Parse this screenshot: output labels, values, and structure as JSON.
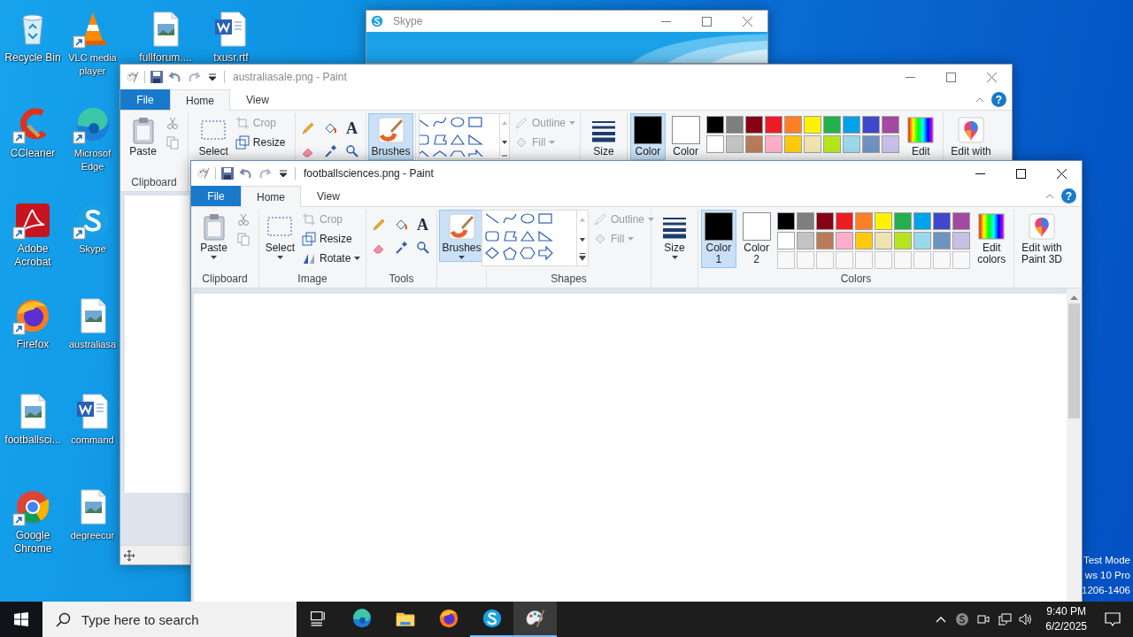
{
  "desktop": {
    "icon_columns": [
      [
        {
          "label": "Recycle Bin",
          "kind": "recycle-bin",
          "shortcut": false
        },
        {
          "label": "CCleaner",
          "kind": "ccleaner",
          "shortcut": true
        },
        {
          "label": "Adobe Acrobat",
          "kind": "acrobat",
          "shortcut": true
        },
        {
          "label": "Firefox",
          "kind": "firefox",
          "shortcut": true
        },
        {
          "label": "footballsci...",
          "kind": "image",
          "shortcut": false
        },
        {
          "label": "Google Chrome",
          "kind": "chrome",
          "shortcut": true
        }
      ],
      [
        {
          "label": "VLC media player",
          "kind": "vlc",
          "shortcut": true
        },
        {
          "label": "Microsof Edge",
          "kind": "edge",
          "shortcut": true
        },
        {
          "label": "Skype",
          "kind": "skype",
          "shortcut": true
        },
        {
          "label": "australiasa",
          "kind": "image",
          "shortcut": false
        },
        {
          "label": "command",
          "kind": "word",
          "shortcut": false
        },
        {
          "label": "degreecur",
          "kind": "image",
          "shortcut": false
        }
      ],
      [
        {
          "label": "fullforum....",
          "kind": "image",
          "shortcut": false
        }
      ],
      [
        {
          "label": "txusr.rtf",
          "kind": "word",
          "shortcut": false
        }
      ]
    ],
    "notice": [
      "Test Mode",
      "ws 10 Pro",
      "1206-1406"
    ]
  },
  "skype_window": {
    "title": "Skype",
    "active": false
  },
  "back_window": {
    "title": "australiasale.png - Paint",
    "active": false,
    "help": "?",
    "tabs": [
      {
        "label": "File",
        "kind": "file",
        "selected": false
      },
      {
        "label": "Home",
        "kind": "tab",
        "selected": true
      },
      {
        "label": "View",
        "kind": "tab",
        "selected": false
      }
    ],
    "ribbon": {
      "clipboard": {
        "label": "Clipboard",
        "paste": "Paste"
      },
      "image": {
        "select": "Select",
        "crop": {
          "label": "Crop",
          "disabled": true
        },
        "resize": {
          "label": "Resize",
          "disabled": false
        }
      },
      "tools": {
        "text_tool": "A"
      },
      "brushes": {
        "label": "Brushes",
        "selected": true
      },
      "shapes": {
        "outline": {
          "label": "Outline",
          "disabled": true
        },
        "fill": {
          "label": "Fill",
          "disabled": true
        }
      },
      "size": {
        "label": "Size"
      },
      "colors": {
        "color1": {
          "label": "Color",
          "color": "#000000",
          "selected": true
        },
        "color2": {
          "label": "Color",
          "color": "#ffffff",
          "selected": false
        },
        "palette": [
          {
            "color": "#000000"
          },
          {
            "color": "#7f7f7f"
          },
          {
            "color": "#880015"
          },
          {
            "color": "#ed1c24"
          },
          {
            "color": "#ff7f27"
          },
          {
            "color": "#fff200"
          },
          {
            "color": "#22b14c"
          },
          {
            "color": "#00a2e8"
          },
          {
            "color": "#3f48cc"
          },
          {
            "color": "#a349a4"
          },
          {
            "color": "#ffffff"
          },
          {
            "color": "#c3c3c3"
          },
          {
            "color": "#b97a57"
          },
          {
            "color": "#ffaec9"
          },
          {
            "color": "#ffc90e"
          },
          {
            "color": "#efe4b0"
          },
          {
            "color": "#b5e61d"
          },
          {
            "color": "#99d9ea"
          },
          {
            "color": "#7092be"
          },
          {
            "color": "#c8bfe7"
          }
        ],
        "edit": "Edit"
      },
      "paint3d": "Edit with"
    }
  },
  "front_window": {
    "title": "footballsciences.png - Paint",
    "active": true,
    "help": "?",
    "tabs": [
      {
        "label": "File",
        "kind": "file",
        "selected": false
      },
      {
        "label": "Home",
        "kind": "tab",
        "selected": true
      },
      {
        "label": "View",
        "kind": "tab",
        "selected": false
      }
    ],
    "ribbon": {
      "clipboard": {
        "label": "Clipboard",
        "paste": "Paste"
      },
      "image": {
        "label": "Image",
        "select": "Select",
        "crop": {
          "label": "Crop",
          "disabled": true
        },
        "resize": {
          "label": "Resize",
          "disabled": false
        },
        "rotate": {
          "label": "Rotate",
          "disabled": false
        }
      },
      "tools": {
        "label": "Tools",
        "text_tool": "A"
      },
      "brushes": {
        "label": "Brushes",
        "selected": true
      },
      "shapes": {
        "label": "Shapes",
        "outline": {
          "label": "Outline",
          "disabled": true
        },
        "fill": {
          "label": "Fill",
          "disabled": true
        }
      },
      "size": {
        "label": "Size"
      },
      "colors": {
        "label": "Colors",
        "color1": {
          "label": "Color 1",
          "color": "#000000",
          "selected": true
        },
        "color2": {
          "label": "Color 2",
          "color": "#ffffff",
          "selected": false
        },
        "palette": [
          {
            "color": "#000000"
          },
          {
            "color": "#7f7f7f"
          },
          {
            "color": "#880015"
          },
          {
            "color": "#ed1c24"
          },
          {
            "color": "#ff7f27"
          },
          {
            "color": "#fff200"
          },
          {
            "color": "#22b14c"
          },
          {
            "color": "#00a2e8"
          },
          {
            "color": "#3f48cc"
          },
          {
            "color": "#a349a4"
          },
          {
            "color": "#ffffff"
          },
          {
            "color": "#c3c3c3"
          },
          {
            "color": "#b97a57"
          },
          {
            "color": "#ffaec9"
          },
          {
            "color": "#ffc90e"
          },
          {
            "color": "#efe4b0"
          },
          {
            "color": "#b5e61d"
          },
          {
            "color": "#99d9ea"
          },
          {
            "color": "#7092be"
          },
          {
            "color": "#c8bfe7"
          }
        ],
        "edit": "Edit colors"
      },
      "paint3d": "Edit with Paint 3D"
    }
  },
  "taskbar": {
    "search": {
      "placeholder": "Type here to search"
    },
    "apps": [
      {
        "kind": "task-view",
        "running": false,
        "selected": false
      },
      {
        "kind": "edge",
        "running": false,
        "selected": false
      },
      {
        "kind": "explorer",
        "running": false,
        "selected": false
      },
      {
        "kind": "firefox",
        "running": false,
        "selected": false
      },
      {
        "kind": "skype",
        "running": true,
        "selected": false
      },
      {
        "kind": "paint",
        "running": true,
        "selected": true
      }
    ],
    "tray": {
      "time": "9:40 PM",
      "date": "6/2/2025"
    }
  }
}
